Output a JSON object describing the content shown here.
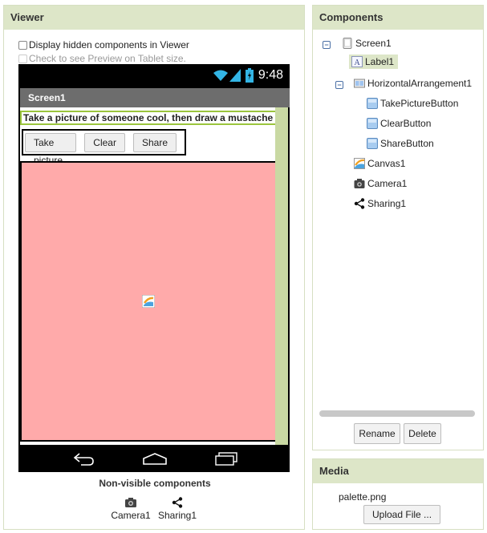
{
  "viewer": {
    "header": "Viewer",
    "hidden_components_label": "Display hidden components in Viewer",
    "tablet_preview_label": "Check to see Preview on Tablet size.",
    "phone": {
      "time": "9:48",
      "screen_title": "Screen1",
      "label_text": "Take a picture of someone cool, then draw a mustache on them!",
      "buttons": [
        "Take picture",
        "Clear",
        "Share"
      ],
      "canvas_color": "#ffaaaa"
    },
    "nonvisible_title": "Non-visible components",
    "nonvisible": [
      {
        "label": "Camera1",
        "icon": "camera-icon"
      },
      {
        "label": "Sharing1",
        "icon": "share-icon"
      }
    ]
  },
  "components": {
    "header": "Components",
    "tree": [
      {
        "label": "Screen1",
        "icon": "screen-icon",
        "level": 0,
        "toggle": "⊟"
      },
      {
        "label": "Label1",
        "icon": "label-icon",
        "level": 1,
        "selected": true
      },
      {
        "label": "HorizontalArrangement1",
        "icon": "arrangement-icon",
        "level": 1,
        "toggle": "⊟"
      },
      {
        "label": "TakePictureButton",
        "icon": "button-icon",
        "level": 2
      },
      {
        "label": "ClearButton",
        "icon": "button-icon",
        "level": 2
      },
      {
        "label": "ShareButton",
        "icon": "button-icon",
        "level": 2
      },
      {
        "label": "Canvas1",
        "icon": "canvas-icon",
        "level": 1
      },
      {
        "label": "Camera1",
        "icon": "camera-icon",
        "level": 1
      },
      {
        "label": "Sharing1",
        "icon": "share-icon",
        "level": 1
      }
    ],
    "rename_label": "Rename",
    "delete_label": "Delete"
  },
  "media": {
    "header": "Media",
    "file": "palette.png",
    "upload_label": "Upload File ..."
  },
  "colors": {
    "header_bg": "#dde6c8",
    "accent_green": "#9bc53d",
    "canvas": "#ffaaaa"
  }
}
